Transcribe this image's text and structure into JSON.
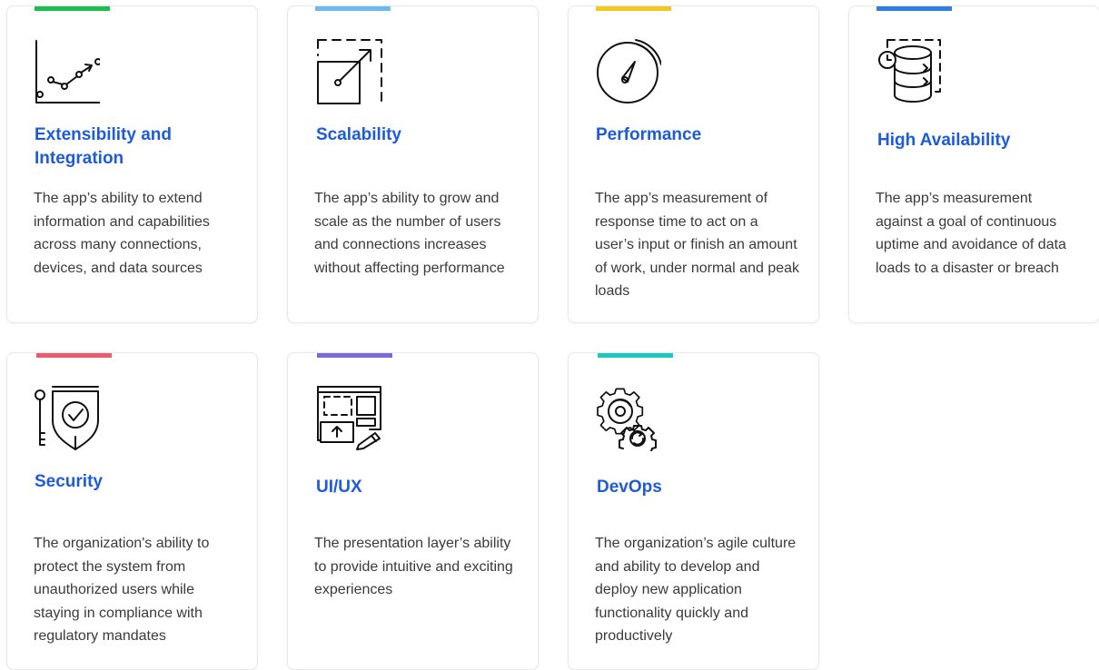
{
  "colors": {
    "title": "#1e5bd8",
    "text": "#3a3a3a",
    "border": "#e6e8ec"
  },
  "cards": [
    {
      "title": "Extensibility and Integration",
      "description": "The app’s ability to extend information and capabilities across many connections, devices, and data sources",
      "accent": "#1bbf4d",
      "icon": "line-chart-icon"
    },
    {
      "title": "Scalability",
      "description": "The app’s ability to grow and scale as the number of users and connections increases without affecting performance",
      "accent": "#6cb8f0",
      "icon": "expand-arrow-icon"
    },
    {
      "title": "Performance",
      "description": "The app’s measurement of response time to act on a user’s input or finish an amount of work, under normal and peak loads",
      "accent": "#f3c81a",
      "icon": "gauge-icon"
    },
    {
      "title": "High Availability",
      "description": "The app’s measurement against a goal of continuous uptime and avoidance of data loads to a disaster or breach",
      "accent": "#2f7de1",
      "icon": "database-clock-icon"
    },
    {
      "title": "Security",
      "description": "The organization's ability to protect the system from unauthorized users while staying in compliance with regulatory mandates",
      "accent": "#ec5b6e",
      "icon": "shield-key-icon"
    },
    {
      "title": "UI/UX",
      "description": "The presentation layer’s ability to provide intuitive and exciting experiences",
      "accent": "#7a6ad8",
      "icon": "wireframe-pen-icon"
    },
    {
      "title": "DevOps",
      "description": "The organization’s agile culture and ability to develop and deploy new application functionality quickly and productively",
      "accent": "#1ec7c0",
      "icon": "gears-cycle-icon"
    }
  ]
}
